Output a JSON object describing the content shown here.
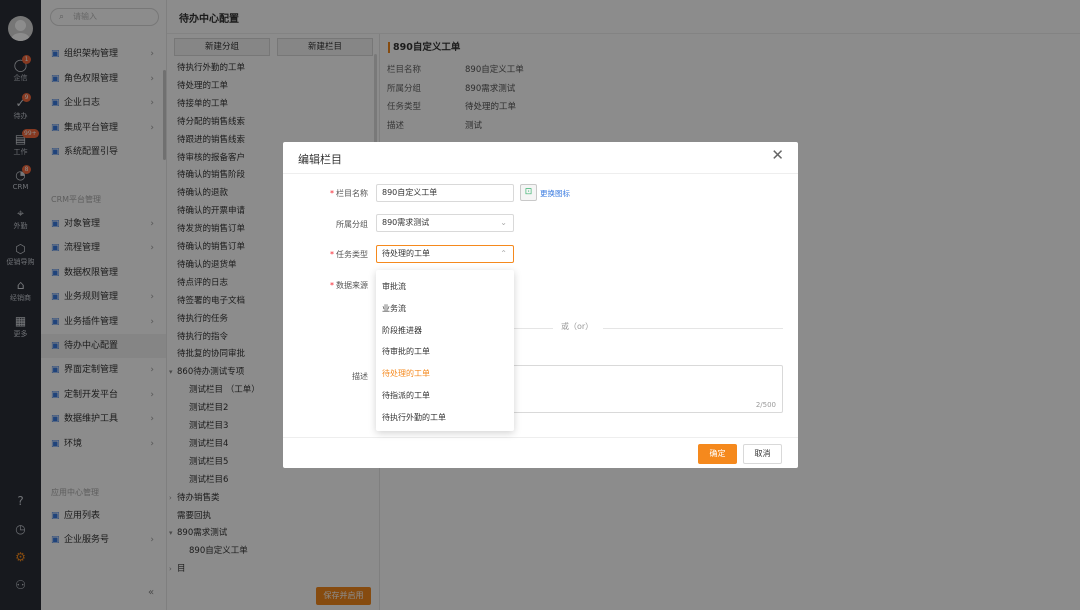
{
  "rail": {
    "items": [
      {
        "label": "企信",
        "icon": "chat-icon",
        "badge": "1"
      },
      {
        "label": "待办",
        "icon": "check-circle-icon",
        "badge": "9"
      },
      {
        "label": "工作",
        "icon": "calendar-icon",
        "badge": "99+"
      },
      {
        "label": "CRM",
        "icon": "pie-chart-icon",
        "badge": "8"
      },
      {
        "label": "外勤",
        "icon": "location-icon",
        "badge": ""
      },
      {
        "label": "促销导购",
        "icon": "box-icon",
        "badge": ""
      },
      {
        "label": "经销商",
        "icon": "store-icon",
        "badge": ""
      },
      {
        "label": "更多",
        "icon": "grid-icon",
        "badge": ""
      }
    ],
    "bottom_icons": [
      "help-icon",
      "clock-icon",
      "settings-icon",
      "user-icon"
    ]
  },
  "nav": {
    "search_placeholder": "请输入",
    "items": [
      {
        "label": "组织架构管理"
      },
      {
        "label": "角色权限管理"
      },
      {
        "label": "企业日志"
      },
      {
        "label": "集成平台管理"
      },
      {
        "label": "系统配置引导"
      }
    ],
    "group1": "CRM平台管理",
    "crm_items": [
      {
        "label": "对象管理"
      },
      {
        "label": "流程管理"
      },
      {
        "label": "数据权限管理"
      },
      {
        "label": "业务规则管理"
      },
      {
        "label": "业务插件管理"
      },
      {
        "label": "待办中心配置"
      },
      {
        "label": "界面定制管理"
      },
      {
        "label": "定制开发平台"
      },
      {
        "label": "数据维护工具"
      },
      {
        "label": "环境"
      }
    ],
    "group2": "应用中心管理",
    "app_items": [
      {
        "label": "应用列表"
      },
      {
        "label": "企业服务号"
      }
    ],
    "collapse": "«"
  },
  "header": {
    "title": "待办中心配置"
  },
  "tree": {
    "new_group": "新建分组",
    "new_column": "新建栏目",
    "items": [
      "待执行外勤的工单",
      "待处理的工单",
      "待接单的工单",
      "待分配的销售线索",
      "待跟进的销售线索",
      "待审核的报备客户",
      "待确认的销售阶段",
      "待确认的退款",
      "待确认的开票申请",
      "待发货的销售订单",
      "待确认的销售订单",
      "待确认的退货单",
      "待点评的日志",
      "待签署的电子文档",
      "待执行的任务",
      "待执行的指令",
      "待批复的协同审批"
    ],
    "group_860": "860待办测试专项",
    "group_860_items": [
      "测试栏目 （工单）",
      "测试栏目2",
      "测试栏目3",
      "测试栏目4",
      "测试栏目5",
      "测试栏目6"
    ],
    "sales": "待办销售类",
    "need_return": "需要回执",
    "group_890": "890需求测试",
    "group_890_items": [
      "890自定义工单"
    ],
    "trailing": "目",
    "save": "保存并启用"
  },
  "detail": {
    "title": "890自定义工单",
    "rows": [
      {
        "label": "栏目名称",
        "value": "890自定义工单"
      },
      {
        "label": "所属分组",
        "value": "890需求测试"
      },
      {
        "label": "任务类型",
        "value": "待处理的工单"
      },
      {
        "label": "描述",
        "value": "测试"
      }
    ]
  },
  "modal": {
    "title": "编辑栏目",
    "close": "✕",
    "name_label": "栏目名称",
    "name_value": "890自定义工单",
    "change_icon": "更换图标",
    "group_label": "所属分组",
    "group_value": "890需求测试",
    "type_label": "任务类型",
    "type_value": "待处理的工单",
    "source_label": "数据来源",
    "or": "或（or）",
    "desc_label": "描述",
    "desc_count": "2/500",
    "ok": "确定",
    "cancel": "取消"
  },
  "dropdown": {
    "options": [
      "审批流",
      "业务流",
      "阶段推进器",
      "待审批的工单",
      "待处理的工单",
      "待指派的工单",
      "待执行外勤的工单"
    ],
    "selected_index": 4
  },
  "colors": {
    "accent": "#f5891d",
    "rail": "#2b2f38",
    "link": "#3a7be0"
  }
}
